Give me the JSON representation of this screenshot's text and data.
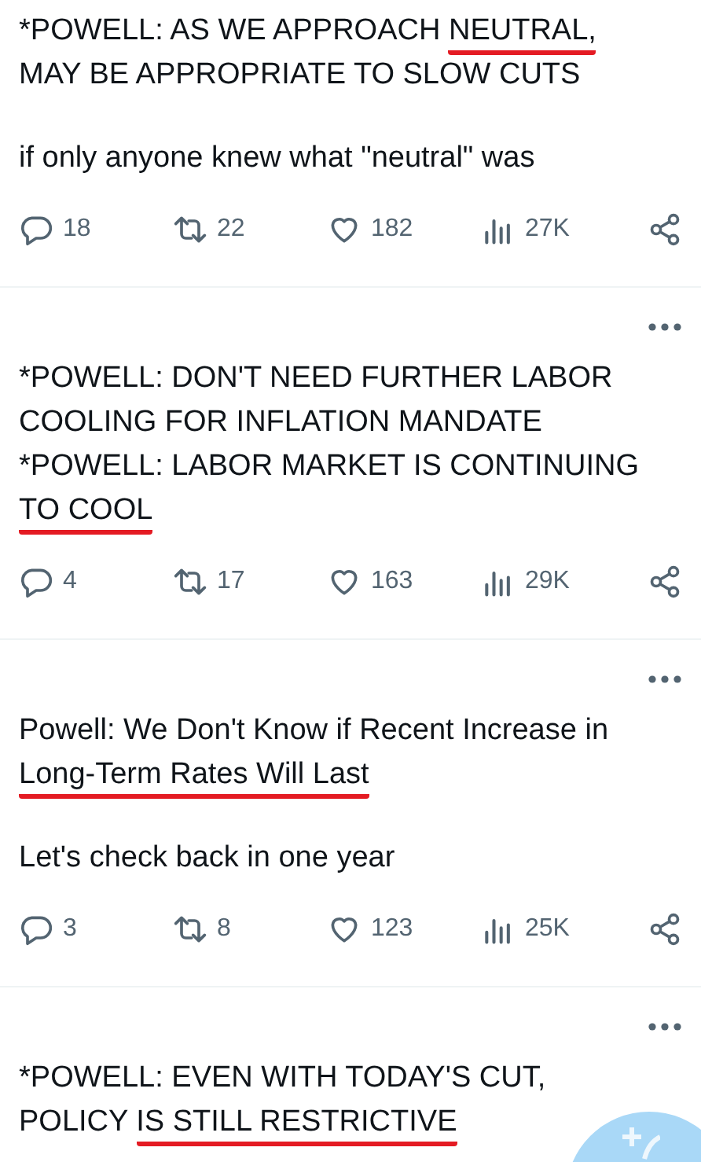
{
  "posts": [
    {
      "has_menu": false,
      "paragraphs": [
        [
          [
            {
              "text": "*POWELL: AS WE APPROACH ",
              "underlined": false
            },
            {
              "text": "NEUTRAL,",
              "underlined": true
            }
          ],
          [
            {
              "text": "MAY BE APPROPRIATE TO SLOW CUTS",
              "underlined": false
            }
          ]
        ],
        [
          [
            {
              "text": "if only anyone knew what \"neutral\" was",
              "underlined": false
            }
          ]
        ]
      ],
      "actions": [
        {
          "kind": "reply",
          "count": "18"
        },
        {
          "kind": "repost",
          "count": "22"
        },
        {
          "kind": "like",
          "count": "182"
        },
        {
          "kind": "views",
          "count": "27K"
        },
        {
          "kind": "share"
        }
      ]
    },
    {
      "has_menu": true,
      "paragraphs": [
        [
          [
            {
              "text": "*POWELL: DON'T NEED FURTHER LABOR",
              "underlined": false
            }
          ],
          [
            {
              "text": "COOLING FOR INFLATION MANDATE",
              "underlined": false
            }
          ],
          [
            {
              "text": "*POWELL: LABOR MARKET IS CONTINUING",
              "underlined": false
            }
          ],
          [
            {
              "text": "TO COOL",
              "underlined": true
            }
          ]
        ]
      ],
      "actions": [
        {
          "kind": "reply",
          "count": "4"
        },
        {
          "kind": "repost",
          "count": "17"
        },
        {
          "kind": "like",
          "count": "163"
        },
        {
          "kind": "views",
          "count": "29K"
        },
        {
          "kind": "share"
        }
      ]
    },
    {
      "has_menu": true,
      "paragraphs": [
        [
          [
            {
              "text": "Powell: We Don't Know if Recent Increase in",
              "underlined": false
            }
          ],
          [
            {
              "text": "Long-Term Rates Will Last",
              "underlined": true
            }
          ]
        ],
        [
          [
            {
              "text": "Let's check back in one year",
              "underlined": false
            }
          ]
        ]
      ],
      "actions": [
        {
          "kind": "reply",
          "count": "3"
        },
        {
          "kind": "repost",
          "count": "8"
        },
        {
          "kind": "like",
          "count": "123"
        },
        {
          "kind": "views",
          "count": "25K"
        },
        {
          "kind": "share"
        }
      ]
    },
    {
      "has_menu": true,
      "paragraphs": [
        [
          [
            {
              "text": "*POWELL: EVEN WITH TODAY'S CUT,",
              "underlined": false
            }
          ],
          [
            {
              "text": "POLICY ",
              "underlined": false
            },
            {
              "text": "IS STILL RESTRICTIVE",
              "underlined": true
            }
          ]
        ]
      ]
    }
  ],
  "compose_button": true
}
